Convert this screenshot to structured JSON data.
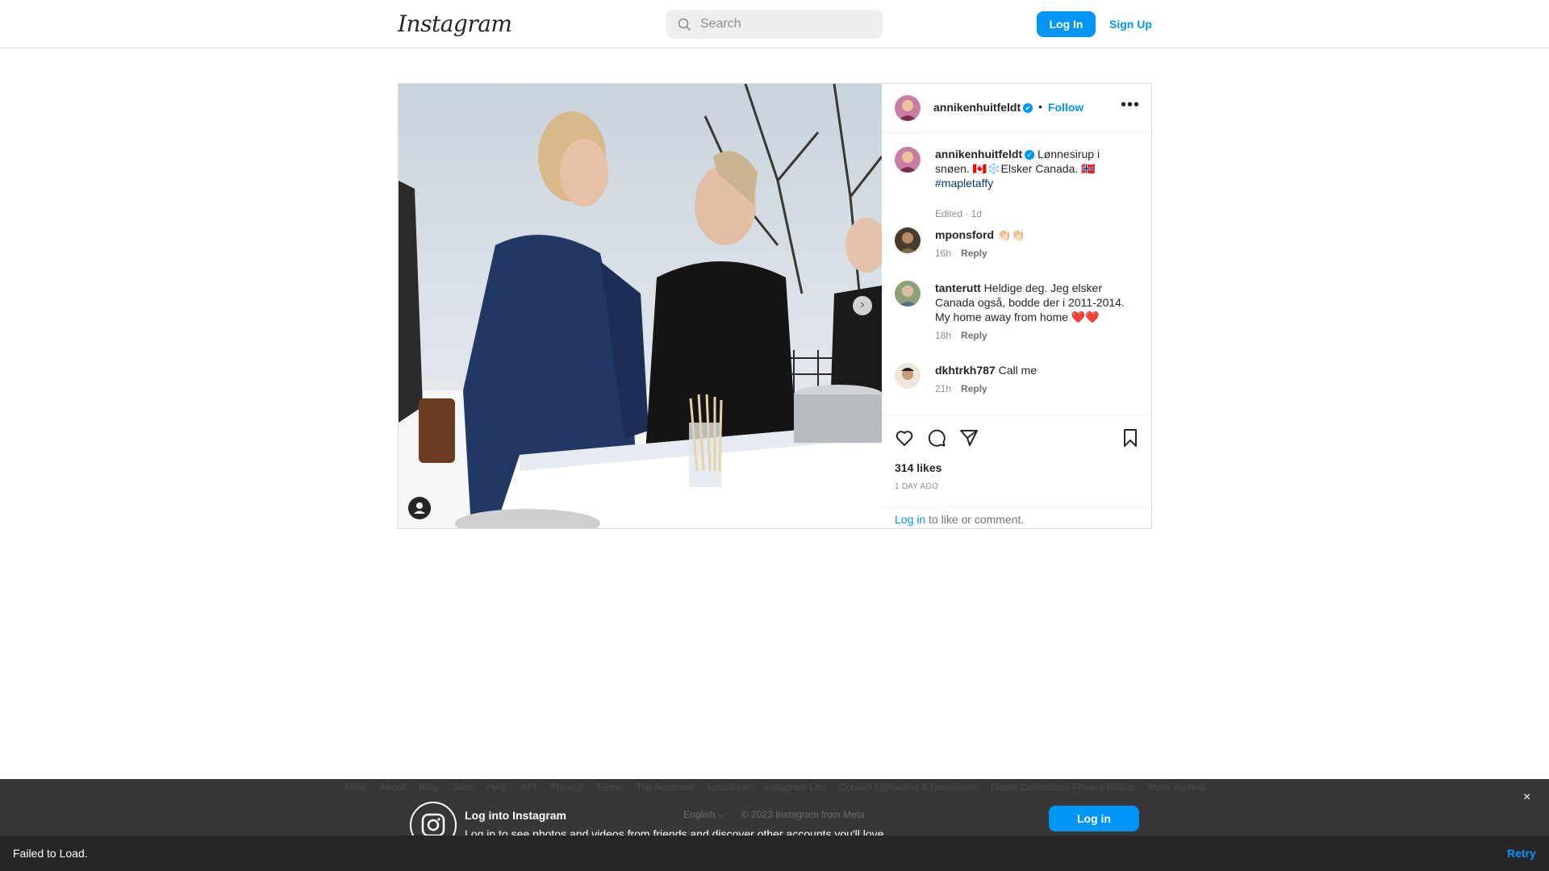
{
  "header": {
    "logo": "Instagram",
    "search_placeholder": "Search",
    "login_label": "Log In",
    "signup_label": "Sign Up"
  },
  "post": {
    "author": "annikenhuitfeldt",
    "follow_label": "Follow",
    "caption": {
      "user": "annikenhuitfeldt",
      "text": "Lønnesirup i snøen. 🇨🇦❄️Elsker Canada. 🇳🇴",
      "hashtag": "#mapletaffy",
      "meta": "Edited · 1d"
    },
    "comments": [
      {
        "user": "mponsford",
        "text": "👏🏻👏🏻",
        "time": "16h",
        "reply": "Reply"
      },
      {
        "user": "tanterutt",
        "text": "Heldige deg. Jeg elsker Canada også, bodde der i 2011-2014. My home away from home ❤️❤️",
        "time": "18h",
        "reply": "Reply"
      },
      {
        "user": "dkhtrkh787",
        "text": "Call me",
        "time": "21h",
        "reply": "Reply"
      }
    ],
    "likes": "314 likes",
    "posted": "1 DAY AGO",
    "login_link": "Log in",
    "login_rest": " to like or comment.",
    "carousel": {
      "count": 4,
      "active": 1
    }
  },
  "footer": {
    "links": [
      "Meta",
      "About",
      "Blog",
      "Jobs",
      "Help",
      "API",
      "Privacy",
      "Terms",
      "Top Accounts",
      "Locations",
      "Instagram Lite",
      "Contact Uploading & Non-Users",
      "Digital Collectibles Privacy Notice",
      "Meta Verified"
    ]
  },
  "overlay": {
    "title": "Log into Instagram",
    "subtitle": "Log in to see photos and videos from friends and discover other accounts you'll love.",
    "language": "English ⌵",
    "copyright": "© 2023 Instagram from Meta",
    "login_button": "Log in",
    "close": "×"
  },
  "toast": {
    "message": "Failed to Load.",
    "retry": "Retry"
  },
  "colors": {
    "accent": "#0095f6",
    "text": "#262626",
    "muted": "#8e8e8e",
    "toast_bg": "#262626"
  }
}
